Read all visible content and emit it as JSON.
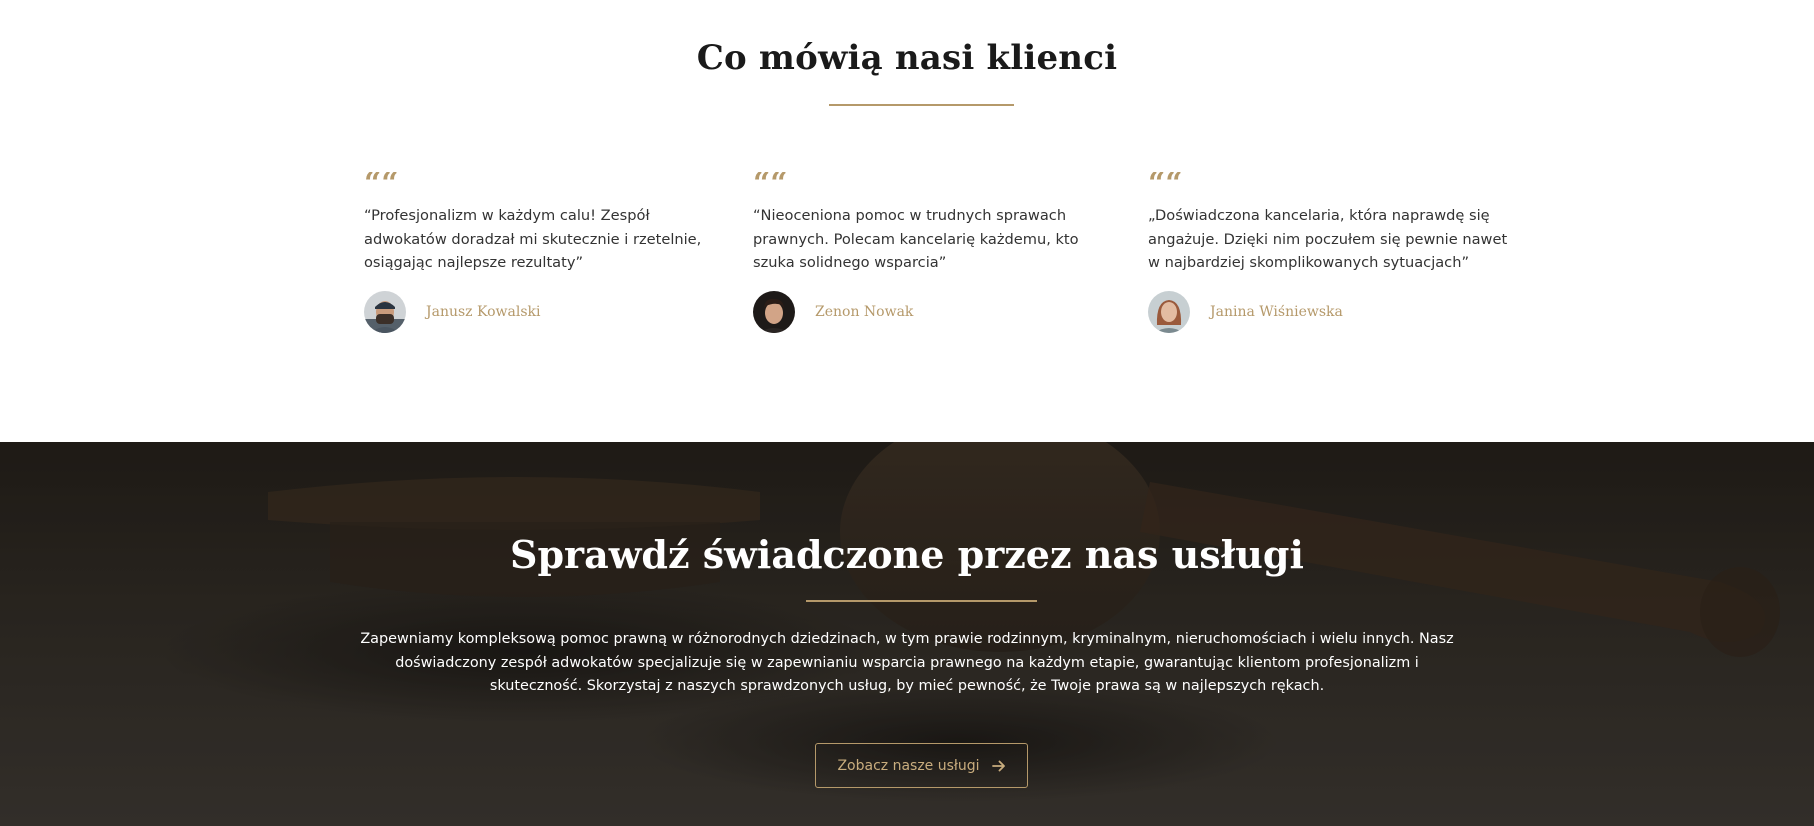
{
  "testimonials": {
    "title": "Co mówią nasi klienci",
    "items": [
      {
        "quote_mark": "““",
        "text": "“Profesjonalizm w każdym calu! Zespół adwokatów doradzał mi skutecznie i rzetelnie, osiągając najlepsze rezultaty”",
        "author": "Janusz Kowalski",
        "avatar_icon": "man-with-cap-avatar"
      },
      {
        "quote_mark": "““",
        "text": "“Nieoceniona pomoc w trudnych sprawach prawnych. Polecam kancelarię każdemu, kto szuka solidnego wsparcia”",
        "author": "Zenon Nowak",
        "avatar_icon": "young-man-avatar"
      },
      {
        "quote_mark": "““",
        "text": "„Doświadczona kancelaria, która naprawdę się angażuje. Dzięki nim poczułem się pewnie nawet w najbardziej skomplikowanych sytuacjach”",
        "author": "Janina Wiśniewska",
        "avatar_icon": "woman-avatar"
      }
    ]
  },
  "services_cta": {
    "title": "Sprawdź świadczone przez nas usługi",
    "text": "Zapewniamy kompleksową pomoc prawną w różnorodnych dziedzinach, w tym prawie rodzinnym, kryminalnym, nieruchomościach i wielu innych. Nasz doświadczony zespół adwokatów specjalizuje się w zapewnianiu wsparcia prawnego na każdym etapie, gwarantując klientom profesjonalizm i skuteczność. Skorzystaj z naszych sprawdzonych usług, by mieć pewność, że Twoje prawa są w najlepszych rękach.",
    "button_label": "Zobacz nasze usługi",
    "button_icon": "arrow-right-icon",
    "background_image": "judge-gavel-photo"
  },
  "colors": {
    "accent": "#b5996a",
    "heading": "#1a1a1a",
    "body_text": "#333333",
    "dark_bg": "#2e2a25"
  }
}
